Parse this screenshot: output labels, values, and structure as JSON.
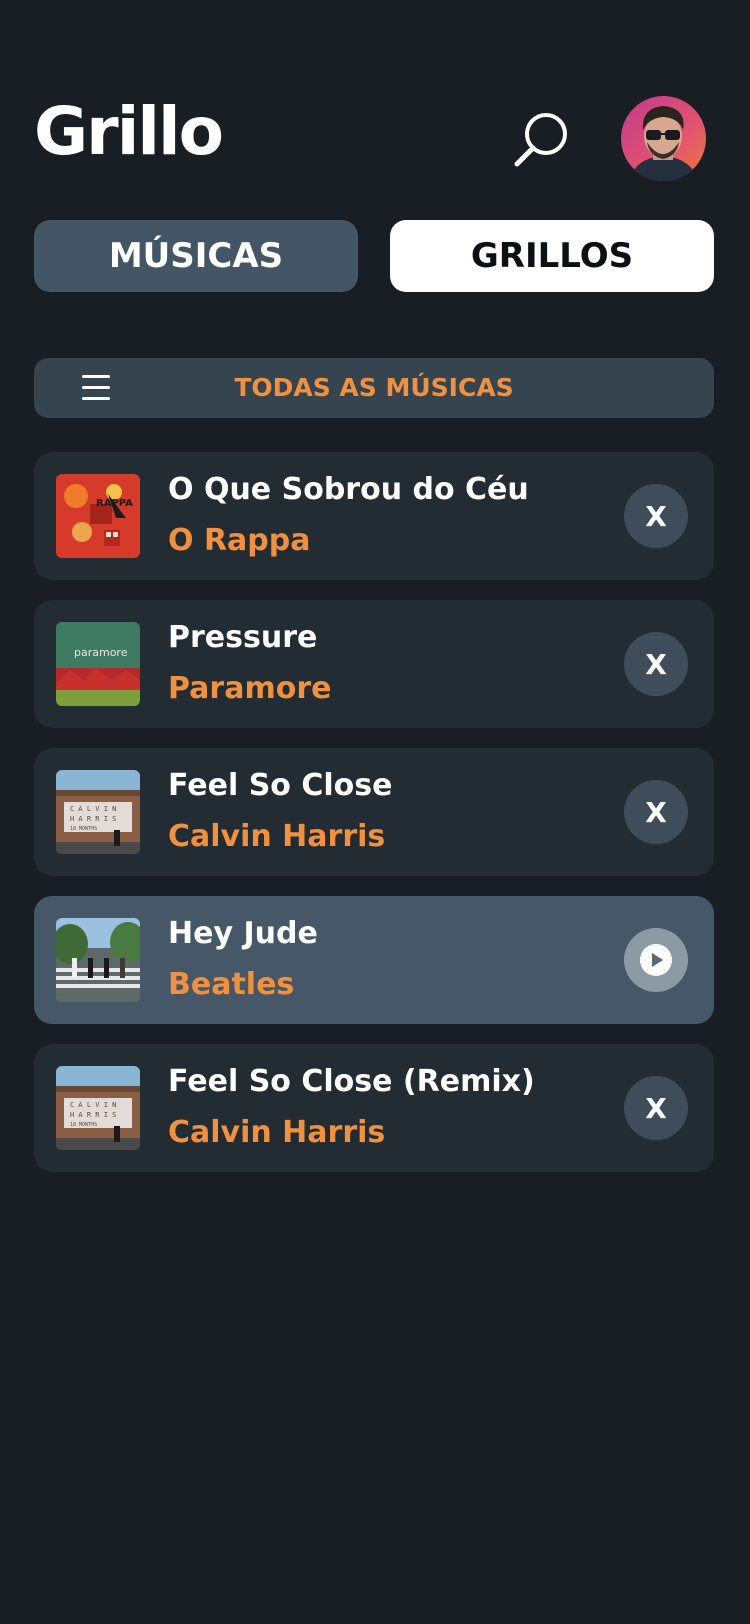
{
  "header": {
    "title": "Grillo",
    "search_icon": "search-icon",
    "avatar_icon": "user-avatar"
  },
  "tabs": [
    {
      "label": "MÚSICAS",
      "selected": false
    },
    {
      "label": "GRILLOS",
      "selected": true
    }
  ],
  "filter": {
    "label": "TODAS AS MÚSICAS",
    "icon": "menu-icon"
  },
  "songs": [
    {
      "title": "O Que Sobrou do Céu",
      "artist": "O Rappa",
      "action": "X",
      "active": false
    },
    {
      "title": "Pressure",
      "artist": "Paramore",
      "action": "X",
      "active": false
    },
    {
      "title": "Feel So Close",
      "artist": "Calvin Harris",
      "action": "X",
      "active": false
    },
    {
      "title": "Hey Jude",
      "artist": "Beatles",
      "action": "play",
      "active": true
    },
    {
      "title": "Feel So Close (Remix)",
      "artist": "Calvin Harris",
      "action": "X",
      "active": false
    }
  ],
  "colors": {
    "background": "#191e25",
    "card": "#232b33",
    "card_active": "#465868",
    "accent": "#f0913f",
    "tab_inactive": "#445566",
    "tab_active": "#ffffff"
  }
}
